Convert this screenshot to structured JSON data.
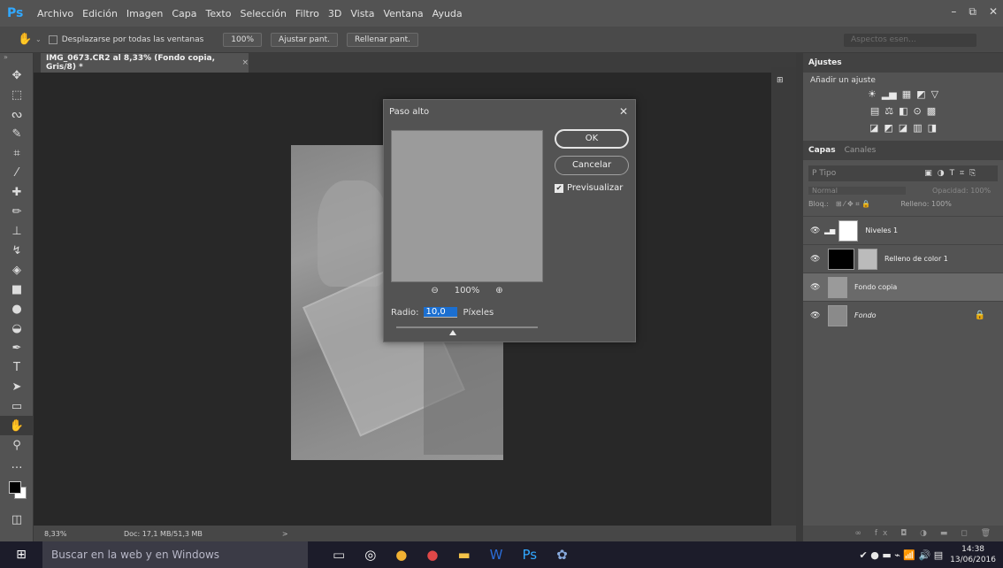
{
  "app": {
    "logo": "Ps",
    "menu": [
      "Archivo",
      "Edición",
      "Imagen",
      "Capa",
      "Texto",
      "Selección",
      "Filtro",
      "3D",
      "Vista",
      "Ventana",
      "Ayuda"
    ],
    "window_controls": [
      "–",
      "⧉",
      "✕"
    ]
  },
  "options_bar": {
    "tool_icon": "hand-icon",
    "scroll_all_label": "Desplazarse por todas las ventanas",
    "zoom_btn": "100%",
    "fit_btn": "Ajustar pant.",
    "fill_btn": "Rellenar pant.",
    "search_placeholder": "Aspectos esen..."
  },
  "document": {
    "tab_title": "IMG_0673.CR2 al 8,33% (Fondo copia, Gris/8) *",
    "tab_close": "×"
  },
  "status": {
    "zoom": "8,33%",
    "doc_info": "Doc: 17,1 MB/51,3 MB",
    "arrow": ">"
  },
  "dialog": {
    "title": "Paso alto",
    "ok": "OK",
    "cancel": "Cancelar",
    "preview_label": "Previsualizar",
    "zoom_level": "100%",
    "radius_label": "Radio:",
    "radius_value": "10,0",
    "radius_unit": "Píxeles",
    "slider_fraction": 0.4
  },
  "adjustments": {
    "tab": "Ajustes",
    "subtitle": "Añadir un ajuste",
    "rows": [
      [
        "☀",
        "▂▅",
        "▦",
        "◩",
        "▽"
      ],
      [
        "▤",
        "⚖",
        "◧",
        "⊙",
        "▩"
      ],
      [
        "◪",
        "◩",
        "◪",
        "▥",
        "◨"
      ]
    ]
  },
  "layers": {
    "tab_active": "Capas",
    "tab_inactive": "Canales",
    "filter_placeholder": "P Tipo",
    "blend_mode": "Normal",
    "opacity_label": "Opacidad: 100%",
    "lock_label": "Bloq.:",
    "fill_label": "Relleno: 100%",
    "items": [
      {
        "name": "Niveles 1",
        "thumb": "#ffffff",
        "selected": false,
        "locked": false
      },
      {
        "name": "Relleno de color 1",
        "thumb": "#000000",
        "selected": false,
        "locked": false
      },
      {
        "name": "Fondo copia",
        "thumb": "#9a9a9a",
        "selected": true,
        "locked": false
      },
      {
        "name": "Fondo",
        "thumb": "#8a8a8a",
        "selected": false,
        "locked": true
      }
    ],
    "footer_icons": "∞ fx ◘ ◑ ▬ ◻ 🗑"
  },
  "taskbar": {
    "start_icon": "windows-icon",
    "search_text": "Buscar en la web y en Windows",
    "time": "14:38",
    "date": "13/06/2016"
  }
}
